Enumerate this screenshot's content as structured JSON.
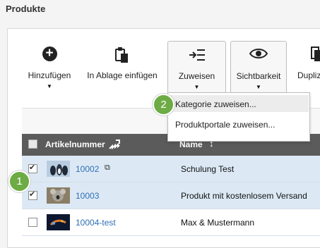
{
  "page": {
    "title": "Produkte"
  },
  "toolbar": {
    "add_label": "Hinzufügen",
    "clipboard_label": "In Ablage einfügen",
    "assign_label": "Zuweisen",
    "visibility_label": "Sichtbarkeit",
    "duplicate_label": "Dupliz"
  },
  "menu": {
    "items": [
      "Kategorie zuweisen...",
      "Produktportale zuweisen..."
    ]
  },
  "table": {
    "headers": {
      "article_number": "Artikelnummer",
      "name": "Name"
    },
    "rows": [
      {
        "article": "10002",
        "name": "Schulung Test",
        "checked": true
      },
      {
        "article": "10003",
        "name": "Produkt mit kostenlosem Versand",
        "checked": true
      },
      {
        "article": "10004-test",
        "name": "Max & Mustermann",
        "checked": false
      }
    ]
  },
  "badges": {
    "one": "1",
    "two": "2"
  },
  "colors": {
    "accent_green": "#6dab44",
    "selected_row": "#dce9f5",
    "header_bg": "#5b5b5b",
    "link_blue": "#2f6fb5"
  }
}
